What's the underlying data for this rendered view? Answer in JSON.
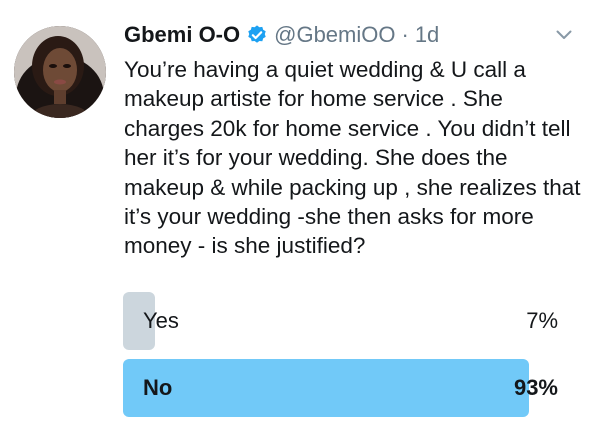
{
  "tweet": {
    "author_name": "Gbemi O-O",
    "handle": "@GbemiOO",
    "separator": "·",
    "time": "1d",
    "verified": true,
    "text": "You’re having a quiet wedding & U call a makeup artiste for home service . She charges 20k for home service . You didn’t tell her it’s for your wedding. She does the makeup & while packing up , she realizes that it’s your wedding -she then asks for more money - is she justified?"
  },
  "poll": {
    "options": [
      {
        "label": "Yes",
        "percent_text": "7%",
        "percent": 7,
        "color": "#ccd6dd"
      },
      {
        "label": "No",
        "percent_text": "93%",
        "percent": 93,
        "color": "#71c9f8"
      }
    ]
  },
  "icons": {
    "verified": "verified-badge-icon",
    "caret": "chevron-down-icon"
  },
  "colors": {
    "verified_blue": "#1da1f2",
    "muted_text": "#657786",
    "leading_bar": "#71c9f8",
    "other_bar": "#ccd6dd"
  }
}
